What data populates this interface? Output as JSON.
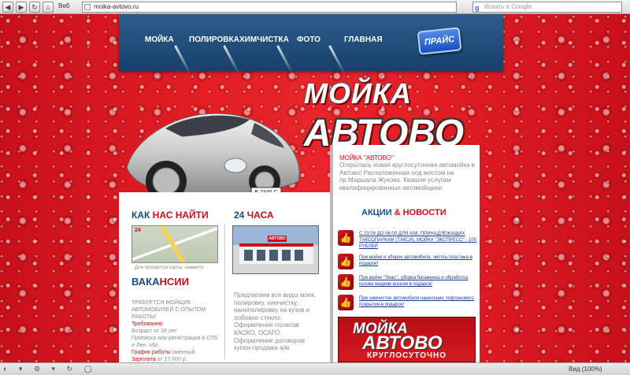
{
  "browser": {
    "web_label": "Веб",
    "url": "moika-avtovo.ru",
    "search_placeholder": "Искать в Google",
    "zoom": "Вид (100%)"
  },
  "nav": {
    "items": [
      "МОЙКА",
      "ПОЛИРОВКА",
      "ХИМЧИСТКА",
      "ФОТО",
      "ГЛАВНАЯ"
    ],
    "price_button": "ПРАЙС"
  },
  "hero": {
    "logo_top": "МОЙКА",
    "logo_bottom": "АВТОВО",
    "plate": "В 2345 С"
  },
  "intro": {
    "title": "МОЙКА \"АВТОВО\"",
    "text": "Открылась новая круглосуточная автомойка в Автово! Расположенная под мостом на пр.Маршала Жукова. Квашни услугам квалифицированные автомойщики."
  },
  "news": {
    "heading_a": "АКЦИИ",
    "heading_amp": "& НОВОСТИ",
    "items": [
      "С 23:00 ДО 06:00 ДЛЯ А/М, ПРИНАДЛЕЖАЩИХ ТАКСОПАРКАМ (ТАКСИ), МОЙКА \"ЭКСПРЕСС\" - 100 РУБЛЕЙ",
      "При мойке и уборке автомобиля, чистка пластика в подарок!",
      "При мойке \"Люкс\", уборка багажника и обработка кузова жидким воском в подарок!",
      "При химчистке автомобиля нанесение тефлонового покрытия в подарок!"
    ],
    "mini_logo_top": "МОЙКА",
    "mini_logo_bottom": "АВТОВО",
    "mini_logo_sub": "КРУГЛОСУТОЧНО"
  },
  "find": {
    "heading_a": "КАК",
    "heading_b": "НАС НАЙТИ",
    "map_label": "24",
    "caption": "Для просмотра карты, нажмите"
  },
  "vacancy": {
    "heading_a": "ВАКА",
    "heading_b": "НСИИ",
    "line1": "ТРЕБУЕТСЯ МОЙЩИК АВТОМОБИЛЕЙ С ОПЫТОМ РАБОТЫ!",
    "req_label": "Требования:",
    "req1": "Возраст от 18 лет",
    "req2": "Прописка или регистрация в СПб и Лен. обл.",
    "sched_label": "График работы",
    "sched_value": "сменный.",
    "pay_label": "Зарплата",
    "pay_value": "от 17 000 р."
  },
  "hours": {
    "heading_a": "24",
    "heading_b": "ЧАСА",
    "photo_sign": "АВТОВО",
    "text": "Предлагаем все виды моек, полировку, химчистку, нанополировку на кузов и лобовое стекло. Оформление полисов КАСКО, ОСАГО. Оформление договоров купли-продажи а/м."
  }
}
